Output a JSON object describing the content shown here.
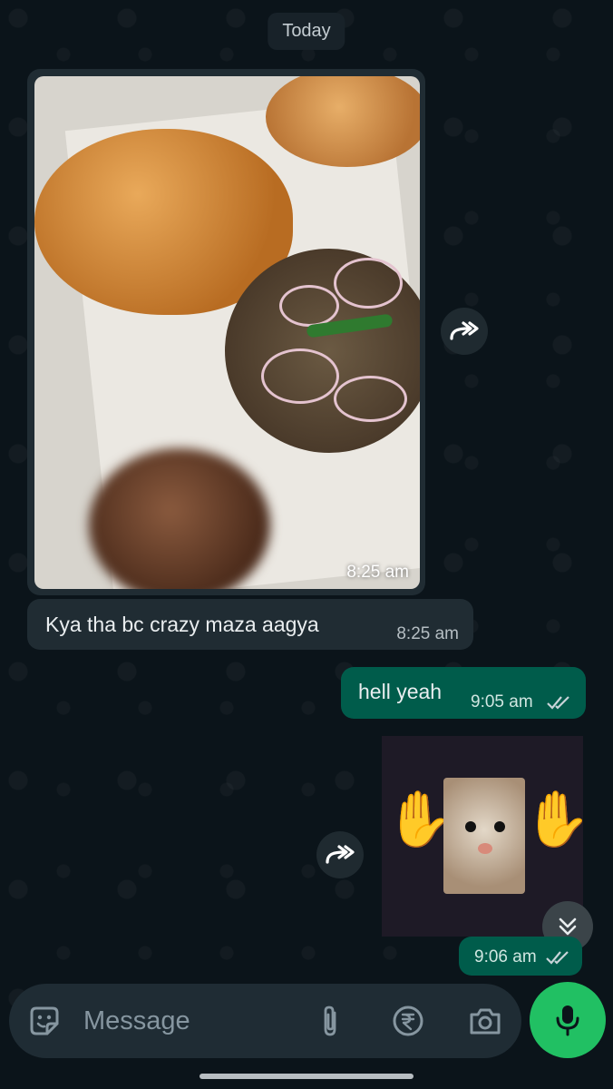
{
  "date_chip": "Today",
  "messages": [
    {
      "type": "image",
      "direction": "incoming",
      "time": "8:25 am"
    },
    {
      "type": "text",
      "direction": "incoming",
      "text": "Kya tha bc crazy maza aagya",
      "time": "8:25 am"
    },
    {
      "type": "text",
      "direction": "outgoing",
      "text": "hell yeah",
      "time": "9:05 am",
      "status": "read"
    },
    {
      "type": "sticker",
      "direction": "outgoing",
      "time": "9:06 am",
      "status": "read"
    }
  ],
  "composer": {
    "placeholder": "Message",
    "icons": [
      "sticker-icon",
      "attach-icon",
      "rupee-payment-icon",
      "camera-icon"
    ],
    "send_icon": "mic-icon"
  },
  "colors": {
    "background": "#0b141a",
    "incoming_bubble": "#202c33",
    "outgoing_bubble": "#005c4b",
    "accent": "#21c063"
  }
}
